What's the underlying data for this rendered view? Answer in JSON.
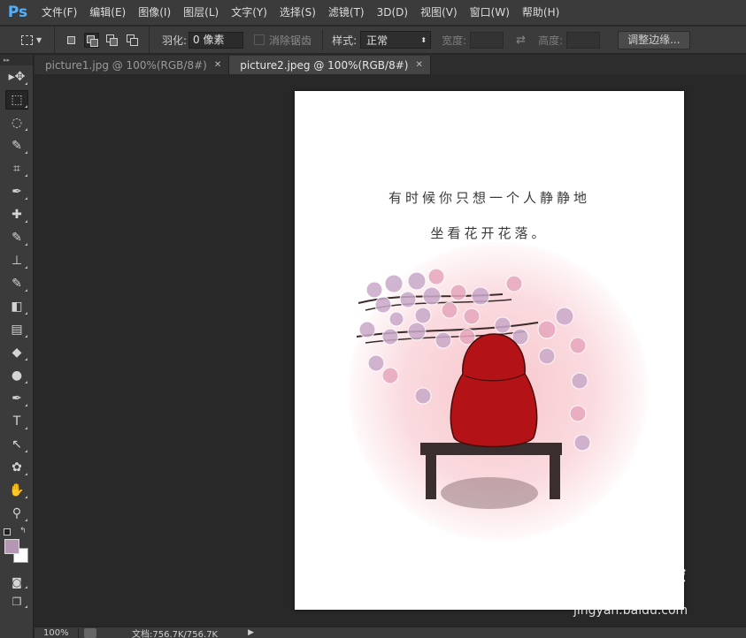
{
  "app": {
    "logo": "Ps"
  },
  "menu": [
    "文件(F)",
    "编辑(E)",
    "图像(I)",
    "图层(L)",
    "文字(Y)",
    "选择(S)",
    "滤镜(T)",
    "3D(D)",
    "视图(V)",
    "窗口(W)",
    "帮助(H)"
  ],
  "options": {
    "feather_label": "羽化:",
    "feather_value": "0 像素",
    "antialias_label": "消除锯齿",
    "style_label": "样式:",
    "style_value": "正常",
    "width_label": "宽度:",
    "height_label": "高度:",
    "refine_edge_label": "调整边缘..."
  },
  "tabs": [
    {
      "label": "picture1.jpg @ 100%(RGB/8#)",
      "active": false
    },
    {
      "label": "picture2.jpeg @ 100%(RGB/8#)",
      "active": true
    }
  ],
  "tools": [
    "move-icon",
    "rect-marquee-icon",
    "lasso-icon",
    "quick-select-icon",
    "crop-icon",
    "eyedropper-icon",
    "healing-brush-icon",
    "brush-icon",
    "clone-stamp-icon",
    "history-brush-icon",
    "eraser-icon",
    "gradient-icon",
    "blur-icon",
    "dodge-icon",
    "pen-icon",
    "type-icon",
    "path-select-icon",
    "custom-shape-icon",
    "hand-icon",
    "zoom-icon"
  ],
  "tool_glyphs": [
    "▸✥",
    "⬚",
    "◌",
    "✎",
    "⌗",
    "✒",
    "✚",
    "✎",
    "⊥",
    "✎",
    "◧",
    "▤",
    "◆",
    "●",
    "✒",
    "T",
    "↖",
    "✿",
    "✋",
    "⚲"
  ],
  "colors": {
    "foreground": "#b597b4",
    "background": "#ffffff",
    "accent": "#4fb0ff",
    "hood": "#b31217"
  },
  "canvas": {
    "line1": "有时候你只想一个人静静地",
    "line2": "坐看花开花落。"
  },
  "watermark": {
    "brand": "Bai du 经验",
    "url": "jingyan.baidu.com"
  },
  "status": {
    "zoom": "100%",
    "doc_info": "文档:756.7K/756.7K"
  }
}
